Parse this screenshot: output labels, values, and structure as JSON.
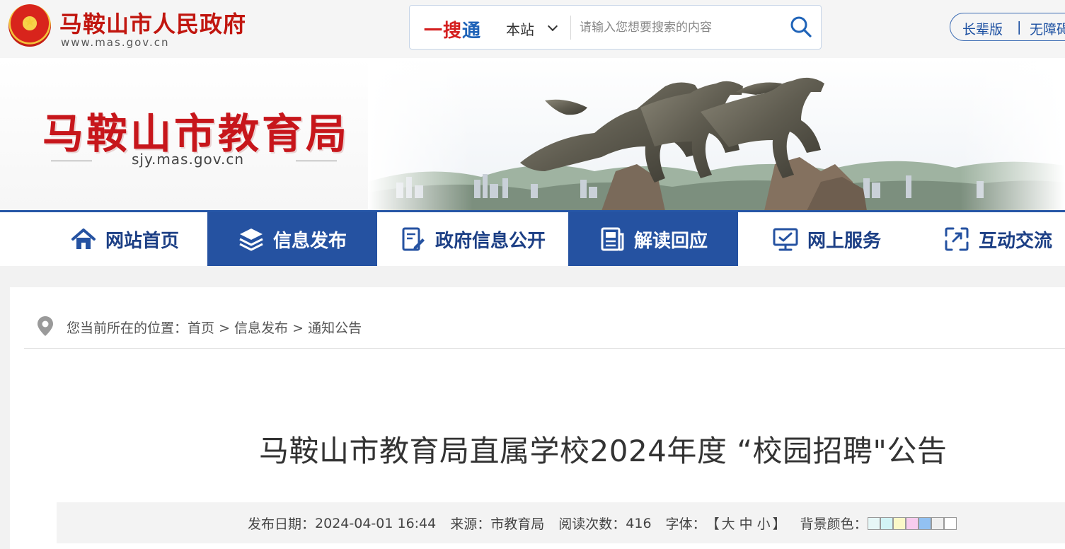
{
  "topbar": {
    "gov_title": "马鞍山市人民政府",
    "gov_url": "www.mas.gov.cn",
    "search": {
      "brand_part1": "一搜",
      "brand_part2": "通",
      "scope": "本站",
      "placeholder": "请输入您想要搜索的内容",
      "value": ""
    },
    "versions": {
      "elder": "长辈版",
      "separator": "|",
      "accessible": "无障碍"
    }
  },
  "banner": {
    "title": "马鞍山市教育局",
    "url": "sjy.mas.gov.cn"
  },
  "nav": {
    "items": [
      {
        "label": "网站首页",
        "icon": "home-icon",
        "active": false
      },
      {
        "label": "信息发布",
        "icon": "layers-icon",
        "active": true
      },
      {
        "label": "政府信息公开",
        "icon": "document-edit-icon",
        "active": false
      },
      {
        "label": "解读回应",
        "icon": "news-icon",
        "active": true
      },
      {
        "label": "网上服务",
        "icon": "monitor-icon",
        "active": false
      },
      {
        "label": "互动交流",
        "icon": "interaction-icon",
        "active": false
      }
    ]
  },
  "breadcrumb": {
    "prefix": "您当前所在的位置：",
    "items": [
      "首页",
      "信息发布",
      "通知公告"
    ],
    "separator": ">"
  },
  "article": {
    "title": "马鞍山市教育局直属学校2024年度 “校园招聘\"公告",
    "meta": {
      "date_label": "发布日期：",
      "date": "2024-04-01 16:44",
      "source_label": "来源：",
      "source": "市教育局",
      "views_label": "阅读次数：",
      "views": "416",
      "font_label": "字体：",
      "font_open": "【",
      "font_large": "大",
      "font_medium": "中",
      "font_small": "小",
      "font_close": "】",
      "bg_label": "背景颜色："
    }
  },
  "colors": {
    "brand_blue": "#2552a1",
    "brand_red": "#c7161b",
    "bg_swatches": [
      "#e6f7f7",
      "#d2f4f6",
      "#fbf8c8",
      "#f7ccee",
      "#92c1f2",
      "#efefef",
      "#ffffff"
    ]
  }
}
